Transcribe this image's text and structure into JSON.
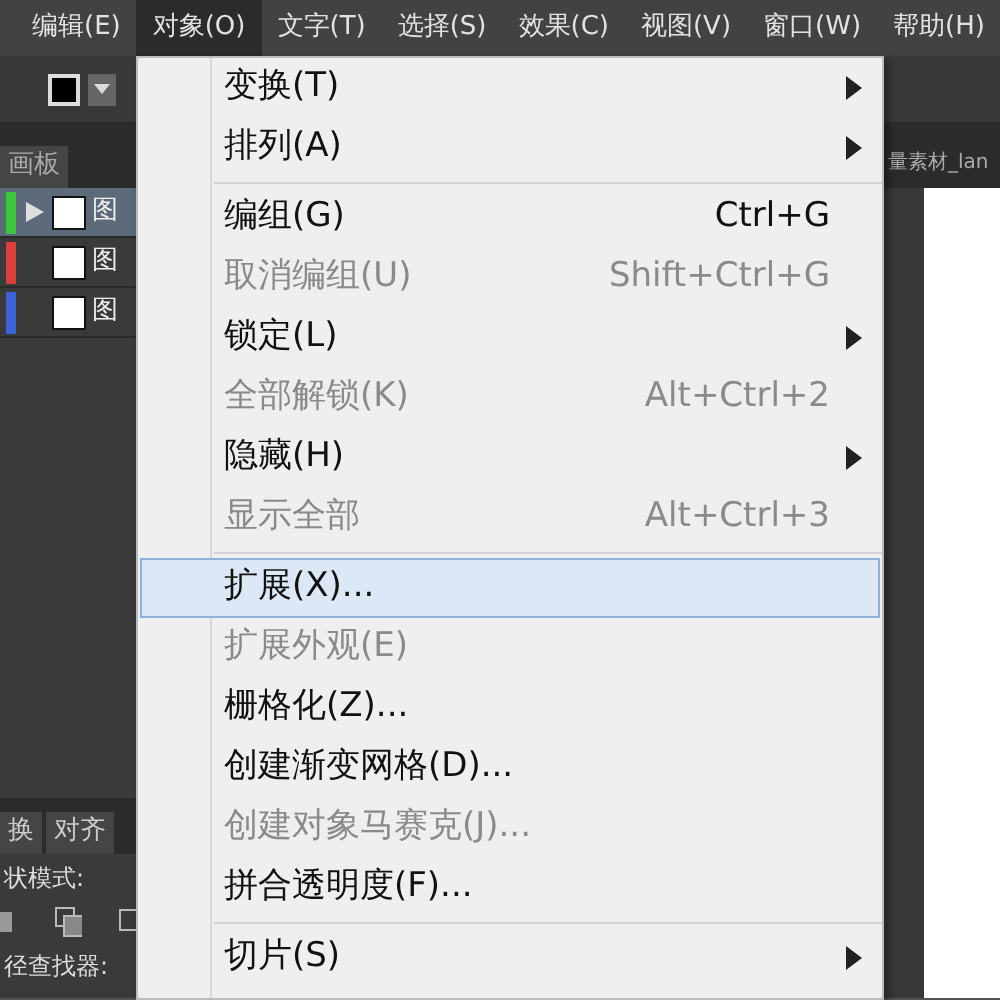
{
  "menu_bar": [
    {
      "label": "编辑(E)",
      "selected": false
    },
    {
      "label": "对象(O)",
      "selected": true
    },
    {
      "label": "文字(T)",
      "selected": false
    },
    {
      "label": "选择(S)",
      "selected": false
    },
    {
      "label": "效果(C)",
      "selected": false
    },
    {
      "label": "视图(V)",
      "selected": false
    },
    {
      "label": "窗口(W)",
      "selected": false
    },
    {
      "label": "帮助(H)",
      "selected": false
    }
  ],
  "document_tab": {
    "label": "量素材_lan"
  },
  "layers_panel": {
    "tab": "画板",
    "layers": [
      {
        "name": "图",
        "color": "#3fc63f",
        "selected": true
      },
      {
        "name": "图",
        "color": "#d9403a",
        "selected": false
      },
      {
        "name": "图",
        "color": "#3b64d8",
        "selected": false
      }
    ]
  },
  "lower_panel": {
    "tabs": [
      {
        "label": "换",
        "selected": false
      },
      {
        "label": "对齐",
        "selected": false
      }
    ],
    "shape_modes_label": "状模式:",
    "pathfinder_label": "径查找器:"
  },
  "menu": {
    "items": [
      {
        "kind": "item",
        "label": "变换(T)",
        "submenu": true,
        "disabled": false,
        "selected": false
      },
      {
        "kind": "item",
        "label": "排列(A)",
        "submenu": true,
        "disabled": false,
        "selected": false
      },
      {
        "kind": "separator"
      },
      {
        "kind": "item",
        "label": "编组(G)",
        "shortcut": "Ctrl+G",
        "submenu": false,
        "disabled": false,
        "selected": false
      },
      {
        "kind": "item",
        "label": "取消编组(U)",
        "shortcut": "Shift+Ctrl+G",
        "submenu": false,
        "disabled": true,
        "selected": false
      },
      {
        "kind": "item",
        "label": "锁定(L)",
        "submenu": true,
        "disabled": false,
        "selected": false
      },
      {
        "kind": "item",
        "label": "全部解锁(K)",
        "shortcut": "Alt+Ctrl+2",
        "submenu": false,
        "disabled": true,
        "selected": false
      },
      {
        "kind": "item",
        "label": "隐藏(H)",
        "submenu": true,
        "disabled": false,
        "selected": false
      },
      {
        "kind": "item",
        "label": "显示全部",
        "shortcut": "Alt+Ctrl+3",
        "submenu": false,
        "disabled": true,
        "selected": false
      },
      {
        "kind": "separator"
      },
      {
        "kind": "item",
        "label": "扩展(X)...",
        "submenu": false,
        "disabled": false,
        "selected": true
      },
      {
        "kind": "item",
        "label": "扩展外观(E)",
        "submenu": false,
        "disabled": true,
        "selected": false
      },
      {
        "kind": "item",
        "label": "栅格化(Z)...",
        "submenu": false,
        "disabled": false,
        "selected": false
      },
      {
        "kind": "item",
        "label": "创建渐变网格(D)...",
        "submenu": false,
        "disabled": false,
        "selected": false
      },
      {
        "kind": "item",
        "label": "创建对象马赛克(J)...",
        "submenu": false,
        "disabled": true,
        "selected": false
      },
      {
        "kind": "item",
        "label": "拼合透明度(F)...",
        "submenu": false,
        "disabled": false,
        "selected": false
      },
      {
        "kind": "separator"
      },
      {
        "kind": "item",
        "label": "切片(S)",
        "submenu": true,
        "disabled": false,
        "selected": false
      }
    ]
  }
}
